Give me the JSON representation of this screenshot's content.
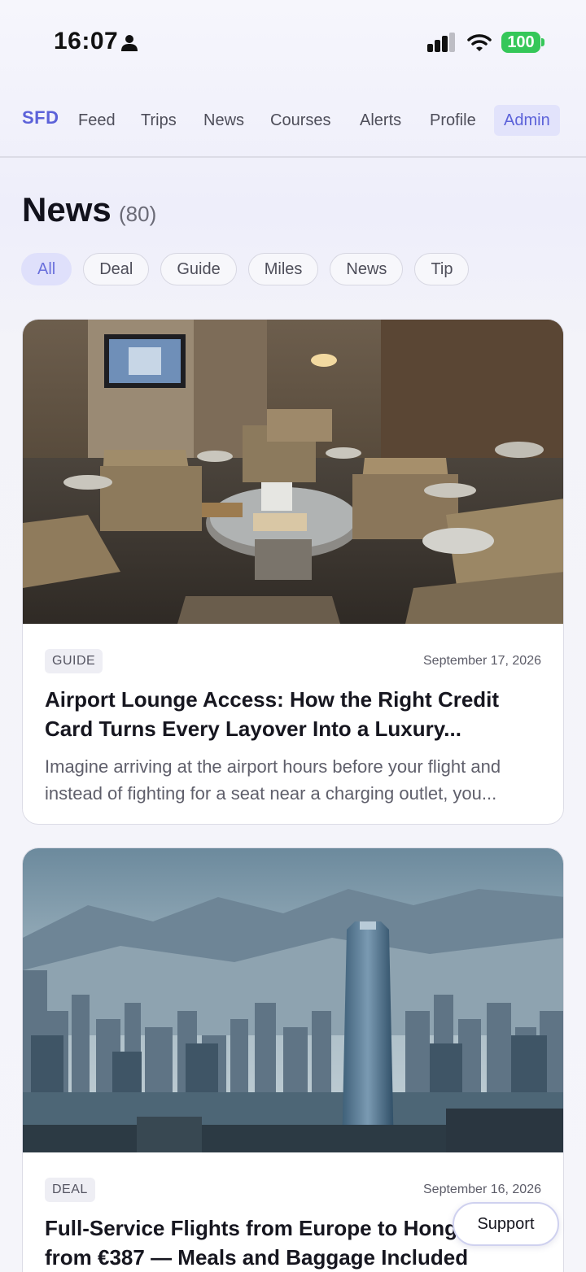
{
  "status_bar": {
    "time": "16:07",
    "battery": "100",
    "icons": [
      "person-icon",
      "signal-icon",
      "wifi-icon",
      "battery-icon"
    ],
    "battery_color": "#35c759"
  },
  "nav": {
    "logo": "SFD",
    "items": [
      "Feed",
      "Trips",
      "News",
      "Courses",
      "Alerts",
      "Profile",
      "Admin"
    ],
    "active": "Admin",
    "accent_color": "#5c62d9"
  },
  "page": {
    "title": "News",
    "count": "(80)"
  },
  "filters": {
    "chips": [
      "All",
      "Deal",
      "Guide",
      "Miles",
      "News",
      "Tip"
    ],
    "active": "All"
  },
  "articles": [
    {
      "tag": "GUIDE",
      "date": "September 17, 2026",
      "title": "Airport Lounge Access: How the Right Credit Card Turns Every Layover Into a Luxury...",
      "excerpt": "Imagine arriving at the airport hours before your flight and instead of fighting for a seat near a charging outlet, you...",
      "image": "airport lounge interior with armchairs"
    },
    {
      "tag": "DEAL",
      "date": "September 16, 2026",
      "title": "Full-Service Flights from Europe to Hong Kong from €387 — Meals and Baggage Included",
      "excerpt": "",
      "image": "Hong Kong skyline with harbour and mountains"
    }
  ],
  "support": {
    "label": "Support"
  }
}
